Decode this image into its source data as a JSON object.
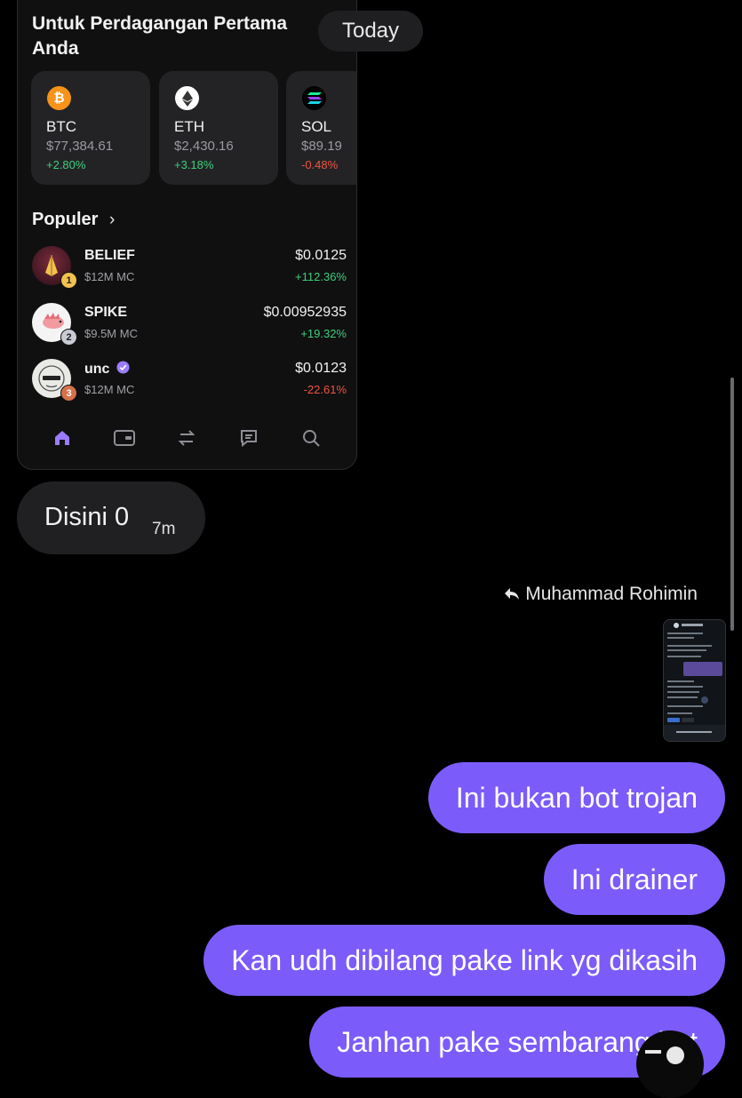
{
  "chat": {
    "date_pill": "Today",
    "incoming": {
      "text": "Disini 0",
      "time": "7m"
    },
    "reply_to": "Muhammad Rohimin",
    "outgoing": [
      "Ini bukan bot trojan",
      "Ini drainer",
      "Kan udh dibilang pake link yg dikasih",
      "Janhan pake sembarang bot"
    ],
    "accent_color": "#7b5cfa"
  },
  "screenshot": {
    "title": "Untuk Perdagangan Pertama Anda",
    "coins": [
      {
        "symbol": "BTC",
        "price": "$77,384.61",
        "change": "+2.80%",
        "direction": "up",
        "icon": "bitcoin-icon"
      },
      {
        "symbol": "ETH",
        "price": "$2,430.16",
        "change": "+3.18%",
        "direction": "up",
        "icon": "ethereum-icon"
      },
      {
        "symbol": "SOL",
        "price": "$89.19",
        "change": "-0.48%",
        "direction": "down",
        "icon": "solana-icon"
      }
    ],
    "section_label": "Populer",
    "tokens": [
      {
        "rank": "1",
        "name": "BELIEF",
        "mc": "$12M MC",
        "price": "$0.0125",
        "change": "+112.36%",
        "direction": "up"
      },
      {
        "rank": "2",
        "name": "SPIKE",
        "mc": "$9.5M MC",
        "price": "$0.00952935",
        "change": "+19.32%",
        "direction": "up"
      },
      {
        "rank": "3",
        "name": "unc",
        "mc": "$12M MC",
        "price": "$0.0123",
        "change": "-22.61%",
        "direction": "down",
        "verified": true
      }
    ],
    "nav": [
      "home-icon",
      "wallet-icon",
      "swap-icon",
      "chat-icon",
      "search-icon"
    ]
  }
}
